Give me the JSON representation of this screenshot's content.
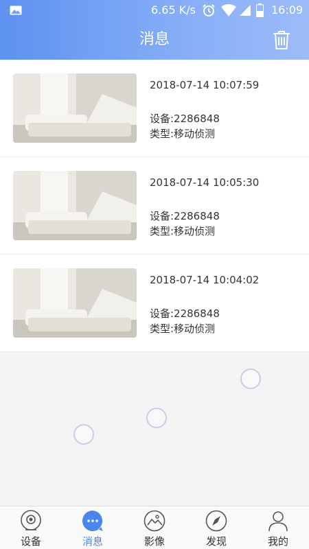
{
  "status_bar": {
    "speed": "6.65 K/s",
    "time": "16:09"
  },
  "header": {
    "title": "消息"
  },
  "messages": [
    {
      "time": "2018-07-14 10:07:59",
      "device": "设备:2286848",
      "type": "类型:移动侦测"
    },
    {
      "time": "2018-07-14 10:05:30",
      "device": "设备:2286848",
      "type": "类型:移动侦测"
    },
    {
      "time": "2018-07-14 10:04:02",
      "device": "设备:2286848",
      "type": "类型:移动侦测"
    }
  ],
  "tabs": [
    {
      "label": "设备",
      "icon": "camera-icon",
      "active": false
    },
    {
      "label": "消息",
      "icon": "chat-bubble-icon",
      "active": true
    },
    {
      "label": "影像",
      "icon": "gallery-icon",
      "active": false
    },
    {
      "label": "发现",
      "icon": "compass-icon",
      "active": false
    },
    {
      "label": "我的",
      "icon": "person-icon",
      "active": false
    }
  ],
  "colors": {
    "accent": "#4a86f0",
    "header_start": "#5d92f0",
    "header_end": "#9dbcf8",
    "background": "#f4f4f4"
  }
}
